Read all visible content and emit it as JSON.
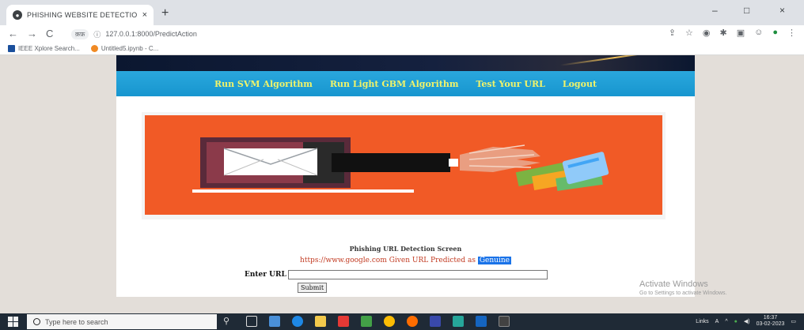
{
  "browser": {
    "tab_title": "PHISHING WEBSITE DETECTION",
    "tab_close": "×",
    "new_tab": "+",
    "window_controls": {
      "minimize": "–",
      "maximize": "□",
      "close": "×"
    },
    "nav": {
      "back": "←",
      "forward": "→",
      "reload": "C"
    },
    "security_chip": "क़फ़",
    "url": "127.0.0.1:8000/PredictAction",
    "bookmarks": [
      {
        "label": "IEEE Xplore Search...",
        "icon": "ieee-icon"
      },
      {
        "label": "Untitled5.ipynb - C...",
        "icon": "colab-icon"
      }
    ]
  },
  "page": {
    "nav_links": [
      "Run SVM Algorithm",
      "Run Light GBM Algorithm",
      "Test Your URL",
      "Logout"
    ],
    "form_title": "Phishing URL Detection Screen",
    "result_prefix": "https://www.google.com Given URL Predicted as",
    "result_value": "Genuine",
    "url_label": "Enter URL",
    "url_value": "",
    "submit_label": "Submit"
  },
  "watermark": {
    "line1": "Activate Windows",
    "line2": "Go to Settings to activate Windows."
  },
  "taskbar": {
    "search_placeholder": "Type here to search",
    "tray_links": "Links",
    "time": "16:37",
    "date": "03-02-2023"
  },
  "colors": {
    "navbar": "#1796cf",
    "nav_link": "#f0f36a",
    "hero_bg": "#f15a26",
    "result_text": "#c23b22",
    "highlight": "#1a73e8"
  }
}
